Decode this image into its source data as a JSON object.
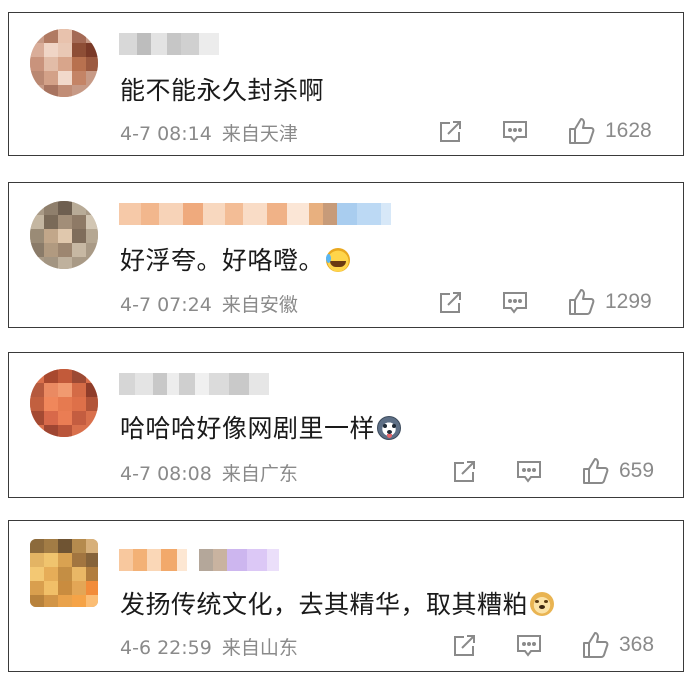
{
  "comments": [
    {
      "text": "能不能永久封杀啊",
      "date": "4-7",
      "time": "08:14",
      "location": "来自天津",
      "likes": "1628",
      "emoji": ""
    },
    {
      "text": "好浮夸。好咯噔。",
      "date": "4-7",
      "time": "07:24",
      "location": "来自安徽",
      "likes": "1299",
      "emoji": "laughing-tears-emoji"
    },
    {
      "text": "哈哈哈好像网剧里一样",
      "date": "4-7",
      "time": "08:08",
      "location": "来自广东",
      "likes": "659",
      "emoji": "husky-face-emoji"
    },
    {
      "text": "发扬传统文化，去其精华，取其糟粕",
      "date": "4-6",
      "time": "22:59",
      "location": "来自山东",
      "likes": "368",
      "emoji": "doge-face-emoji"
    }
  ],
  "icons": {
    "share": "share-icon",
    "comment": "comment-icon",
    "like": "thumbs-up-icon"
  },
  "colors": {
    "meta_text": "#8a8a8a",
    "icon_stroke": "#8a8a8a",
    "border": "#3a3a3a"
  }
}
